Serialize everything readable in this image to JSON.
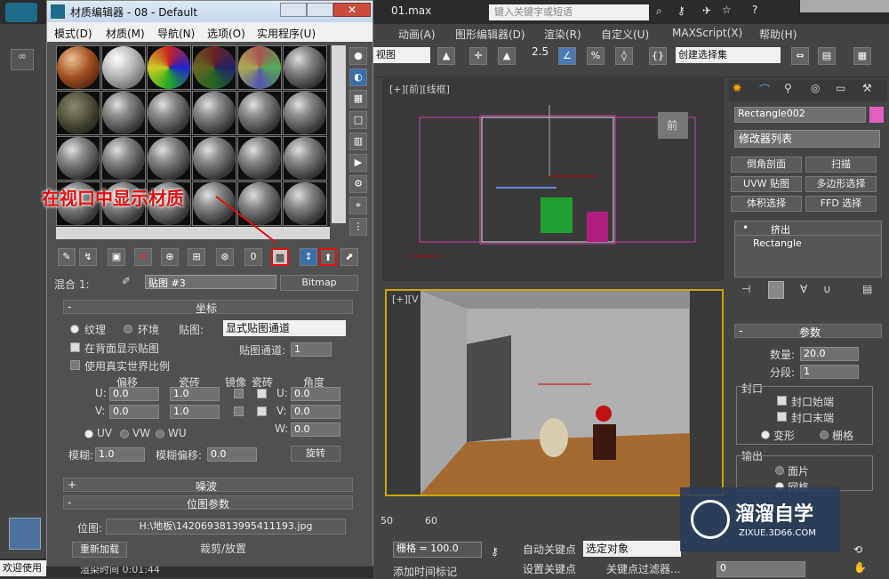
{
  "app": {
    "file_title": "01.max",
    "search_placeholder": "键入关键字或短语"
  },
  "main_menu": [
    "动画(A)",
    "图形编辑器(D)",
    "渲染(R)",
    "自定义(U)",
    "MAXScript(X)",
    "帮助(H)"
  ],
  "toolbar2": {
    "view_label": "视图",
    "num_label": "2.5",
    "sel_set": "创建选择集"
  },
  "viewports": {
    "front_label": "[+][前][线框]",
    "persp_label": "[+][V",
    "front_cube": "前"
  },
  "material_editor": {
    "title": "材质编辑器 - 08 - Default",
    "menu": [
      "模式(D)",
      "材质(M)",
      "导航(N)",
      "选项(O)",
      "实用程序(U)"
    ],
    "annotation": "在视口中显示材质",
    "blend_label": "混合 1:",
    "map_name": "贴图 #3",
    "map_type": "Bitmap",
    "coords": {
      "title": "坐标",
      "radio_texture": "纹理",
      "radio_env": "环境",
      "mapping_label": "贴图:",
      "mapping_value": "显式贴图通道",
      "show_back": "在背面显示贴图",
      "map_channel_label": "贴图通道:",
      "map_channel_value": "1",
      "real_world": "使用真实世界比例",
      "col_offset": "偏移",
      "col_tiling": "瓷砖",
      "col_mirror": "镜像",
      "col_tile": "瓷砖",
      "col_angle": "角度",
      "u_label": "U:",
      "v_label": "V:",
      "w_label": "W:",
      "u_offset": "0.0",
      "v_offset": "0.0",
      "u_tiling": "1.0",
      "v_tiling": "1.0",
      "u_angle": "0.0",
      "v_angle": "0.0",
      "w_angle": "0.0",
      "uv": "UV",
      "vw": "VW",
      "wu": "WU",
      "blur_label": "模糊:",
      "blur_value": "1.0",
      "blur_offset_label": "模糊偏移:",
      "blur_offset_value": "0.0",
      "rotate_btn": "旋转"
    },
    "noise_title": "噪波",
    "bitmap_params_title": "位图参数",
    "bitmap_label": "位图:",
    "bitmap_path": "H:\\地板\\1420693813995411193.jpg",
    "reload_btn": "重新加载",
    "crop_label": "裁剪/放置"
  },
  "command_panel": {
    "object_name": "Rectangle002",
    "object_color": "#e060c0",
    "modifier_list": "修改器列表",
    "buttons": [
      "倒角剖面",
      "扫描",
      "UVW 贴图",
      "多边形选择",
      "体积选择",
      "FFD 选择"
    ],
    "stack": [
      "挤出",
      "Rectangle"
    ],
    "params_title": "参数",
    "amount_label": "数量:",
    "amount_value": "20.0",
    "segments_label": "分段:",
    "segments_value": "1",
    "capping_title": "封口",
    "cap_start": "封口始端",
    "cap_end": "封口末端",
    "morph": "变形",
    "grid": "栅格",
    "output_title": "输出",
    "patch": "面片",
    "mesh": "网格"
  },
  "bottom": {
    "grid_label": "栅格 = 100.0",
    "auto_key": "自动关键点",
    "set_key": "设置关键点",
    "selected_obj": "选定对象",
    "key_filter": "关键点过滤器...",
    "add_time_tag": "添加时间标记",
    "frame": "0",
    "ruler": [
      "50",
      "60"
    ]
  },
  "status": {
    "welcome": "欢迎使用",
    "render_time": "渲染时间  0:01:44"
  },
  "watermark": {
    "brand": "溜溜自学",
    "url": "ZIXUE.3D66.COM"
  },
  "colors": {
    "accent_red": "#e01010",
    "viewport_active": "#c8a800"
  }
}
